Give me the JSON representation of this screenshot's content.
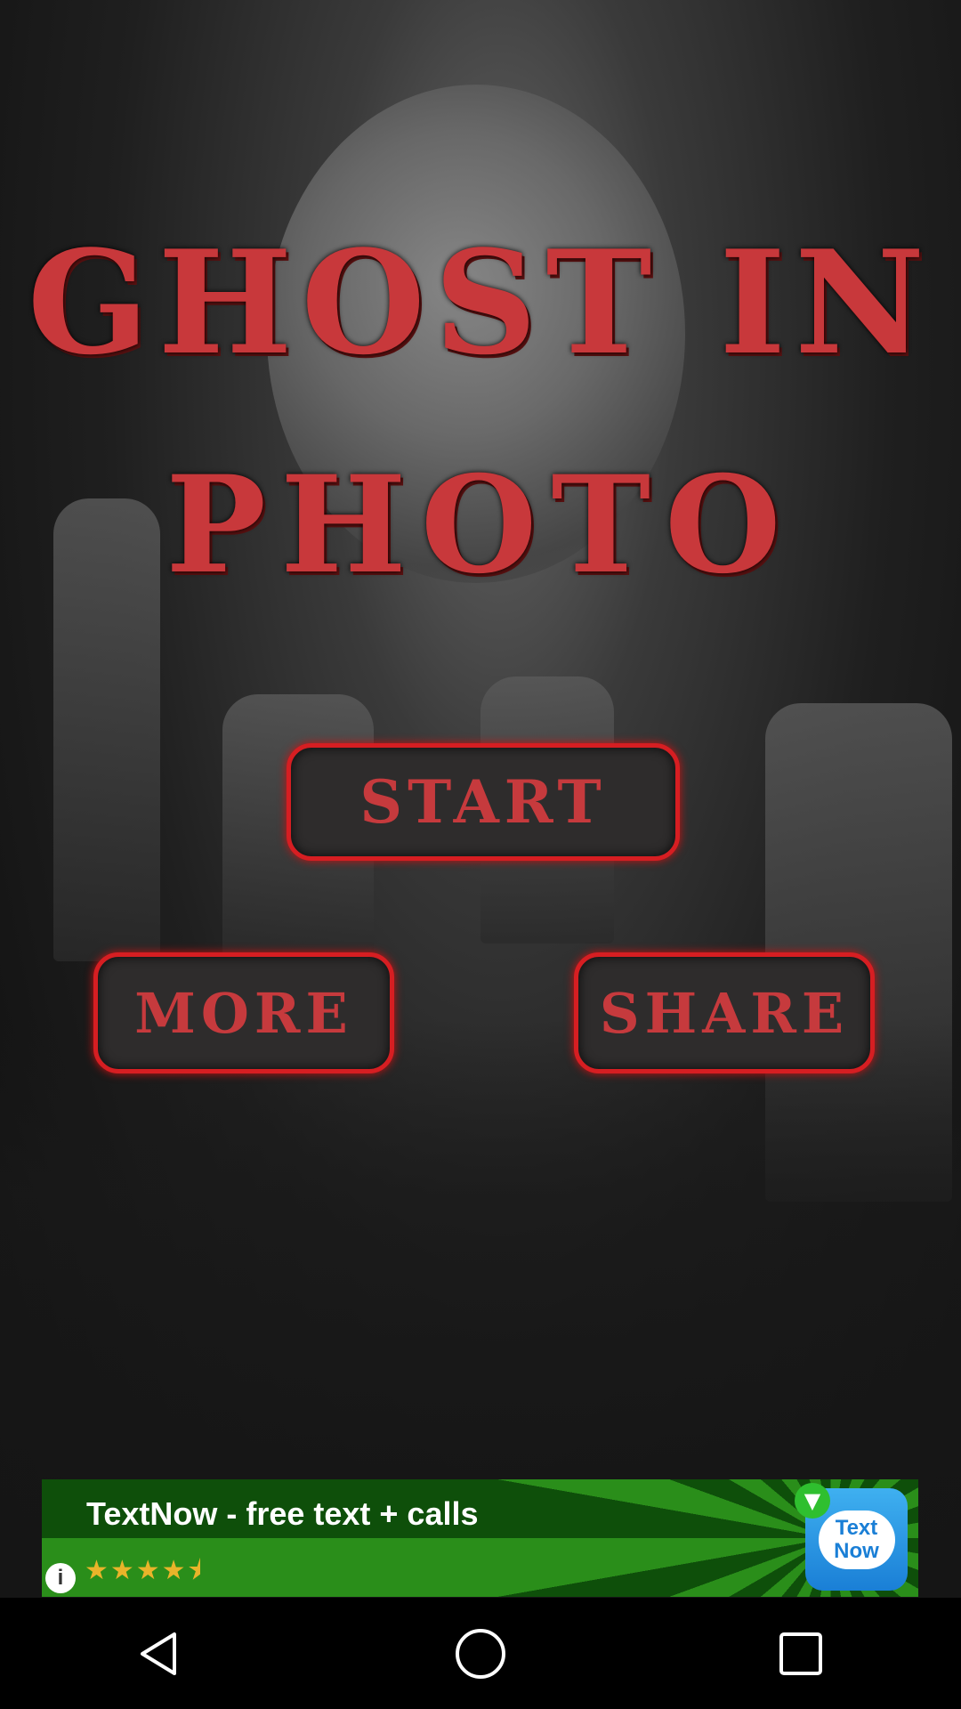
{
  "app": {
    "title_line1": "GHOST IN",
    "title_line2": "PHOTO"
  },
  "menu": {
    "start_label": "START",
    "more_label": "MORE",
    "share_label": "SHARE"
  },
  "ad": {
    "title": "TextNow - free text + calls",
    "rating_stars": "★★★★⯨",
    "info_glyph": "i",
    "logo_text": "Text Now"
  },
  "navbar": {
    "back": "back-icon",
    "home": "home-icon",
    "recents": "recents-icon"
  },
  "colors": {
    "accent_red": "#d61e22",
    "button_bg": "#2e2c2c",
    "ad_green": "#2a8e1a"
  }
}
